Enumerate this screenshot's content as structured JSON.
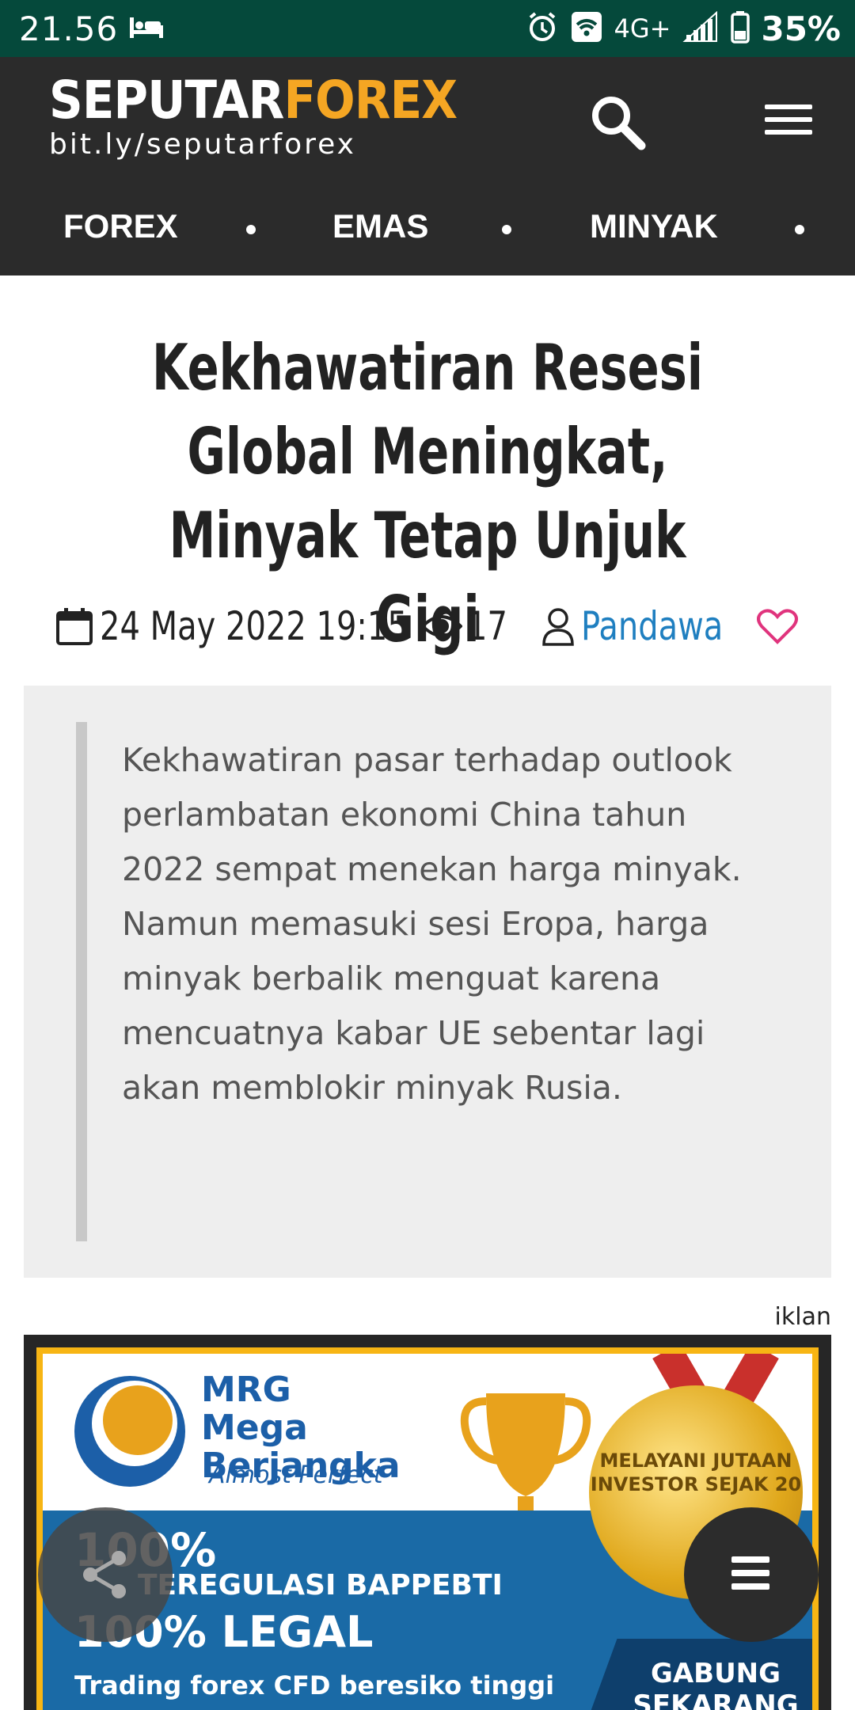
{
  "status_bar": {
    "time": "21.56",
    "network": "4G+",
    "battery": "35%"
  },
  "header": {
    "logo_part1": "SEPUTAR",
    "logo_part2": "FOREX",
    "logo_sub": "bit.ly/seputarforex",
    "nav": [
      {
        "label": "FOREX"
      },
      {
        "label": "EMAS"
      },
      {
        "label": "MINYAK"
      }
    ]
  },
  "article": {
    "title": "Kekhawatiran Resesi Global Meningkat, Minyak Tetap Unjuk Gigi",
    "date": "24 May 2022 19:15",
    "views": "17",
    "author": "Pandawa",
    "summary": "Kekhawatiran pasar terhadap outlook perlambatan ekonomi China tahun 2022 sempat menekan harga minyak. Namun memasuki sesi Eropa, harga minyak berbalik menguat karena mencuatnya kabar UE sebentar lagi akan memblokir minyak Rusia."
  },
  "ad": {
    "label": "iklan",
    "brand": "MRG Mega Berjangka",
    "tagline": "Almost Perfect",
    "line1": "100%",
    "line2": "TEREGULASI BAPPEBTI",
    "line3": "100% LEGAL",
    "line4": "Trading forex CFD beresiko tinggi",
    "medal": "MELAYANI JUTAAN INVESTOR SEJAK 20",
    "cta": "GABUNG SEKARANG"
  },
  "colors": {
    "status_bar": "#05493b",
    "header": "#2b2b2b",
    "logo_accent": "#f5a623",
    "author_link": "#1f7fc0",
    "heart": "#e0347d"
  }
}
